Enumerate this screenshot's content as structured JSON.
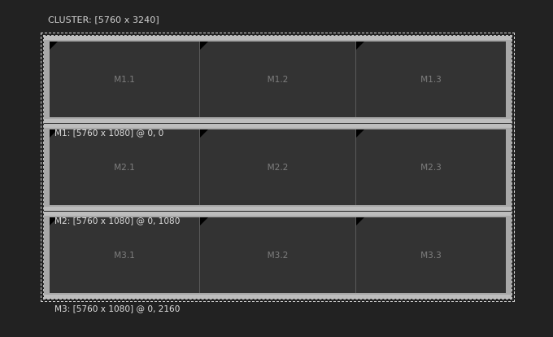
{
  "cluster": {
    "label": "CLUSTER: [5760 x 3240]"
  },
  "monitors": [
    {
      "label": "M1: [5760 x 1080] @ 0, 0",
      "screens": [
        "M1.1",
        "M1.2",
        "M1.3"
      ]
    },
    {
      "label": "M2: [5760 x 1080] @ 0, 1080",
      "screens": [
        "M2.1",
        "M2.2",
        "M2.3"
      ]
    },
    {
      "label": "M3: [5760 x 1080] @ 0, 2160",
      "screens": [
        "M3.1",
        "M3.2",
        "M3.3"
      ]
    }
  ],
  "colors": {
    "background": "#222222",
    "bezel": "#a8a8a8",
    "screen": "#333333"
  }
}
